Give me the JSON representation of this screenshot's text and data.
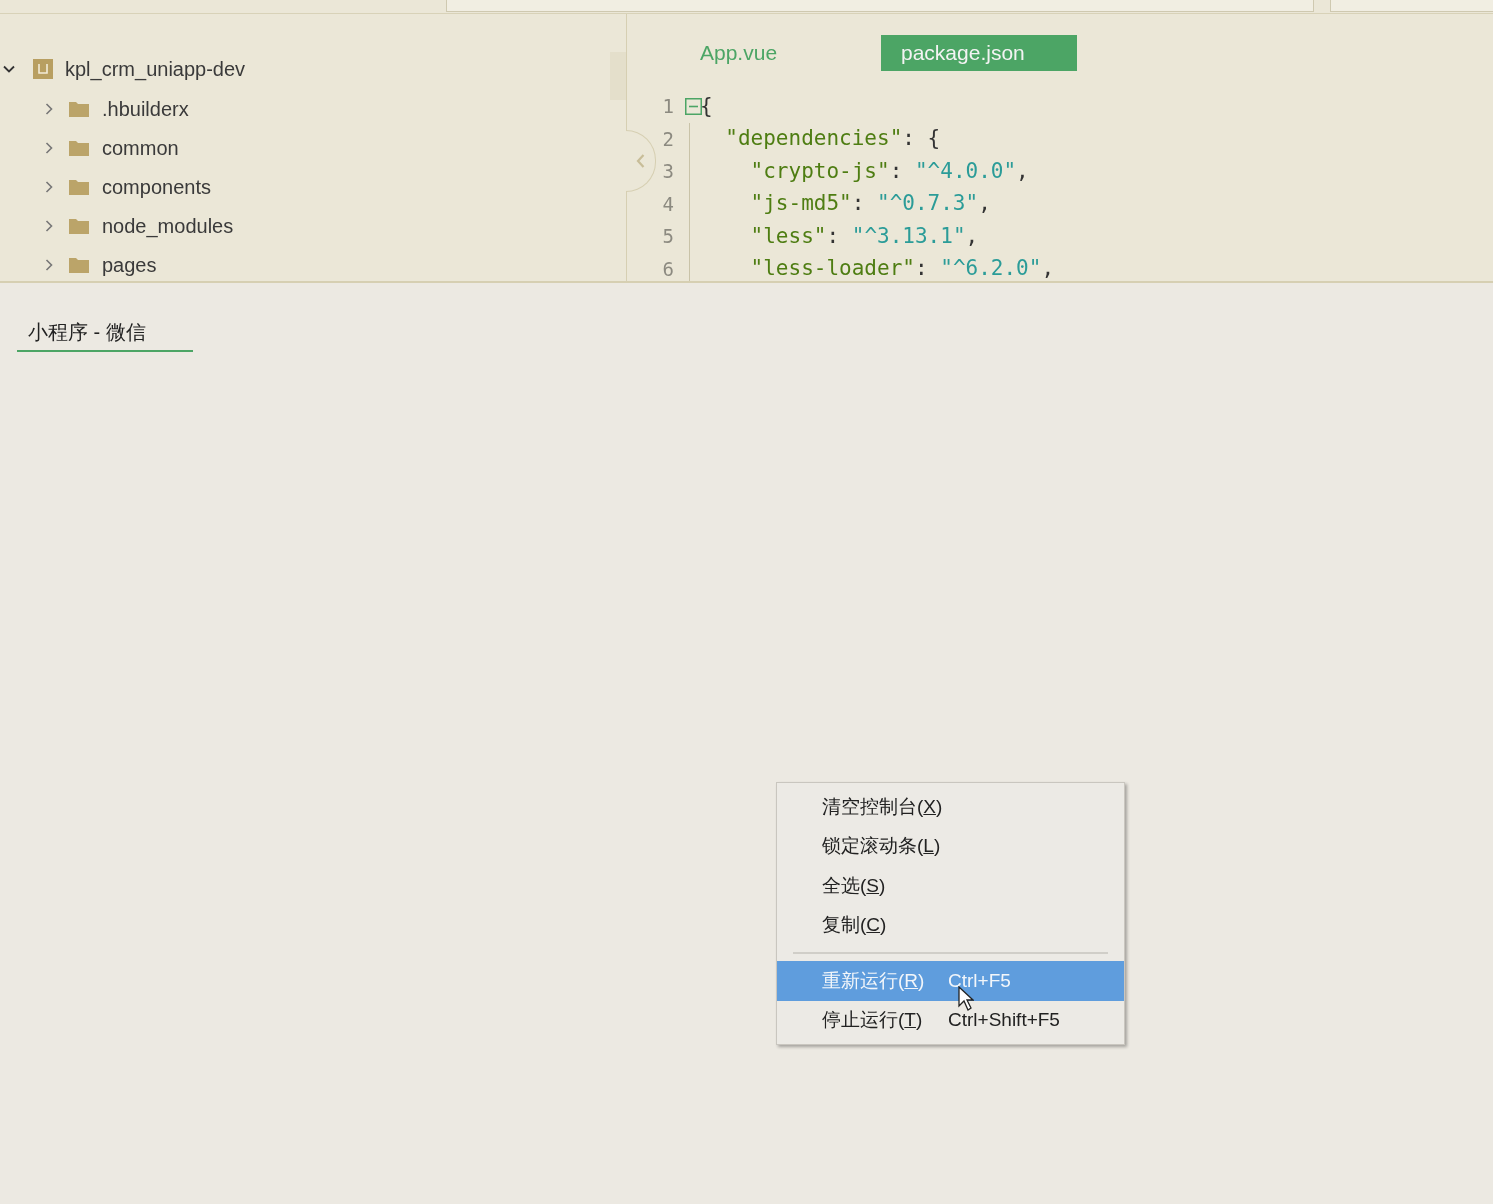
{
  "project_tree": {
    "root": {
      "label": "kpl_crm_uniapp-dev",
      "expanded": true,
      "children": [
        {
          "label": ".hbuilderx",
          "expanded": false
        },
        {
          "label": "common",
          "expanded": false
        },
        {
          "label": "components",
          "expanded": false
        },
        {
          "label": "node_modules",
          "expanded": false
        },
        {
          "label": "pages",
          "expanded": false
        }
      ]
    }
  },
  "editor": {
    "tabs": [
      {
        "label": "App.vue",
        "selected": false
      },
      {
        "label": "package.json",
        "selected": true
      }
    ],
    "lines": [
      {
        "number": "1",
        "foldable": true,
        "tokens": [
          {
            "kind": "punct",
            "text": "{"
          }
        ]
      },
      {
        "number": "2",
        "foldable": false,
        "tokens": [
          {
            "kind": "key",
            "text": "  \"dependencies\""
          },
          {
            "kind": "punct",
            "text": ": {"
          }
        ]
      },
      {
        "number": "3",
        "foldable": false,
        "tokens": [
          {
            "kind": "key",
            "text": "    \"crypto-js\""
          },
          {
            "kind": "punct",
            "text": ": "
          },
          {
            "kind": "string",
            "text": "\"^4.0.0\""
          },
          {
            "kind": "punct",
            "text": ","
          }
        ]
      },
      {
        "number": "4",
        "foldable": false,
        "tokens": [
          {
            "kind": "key",
            "text": "    \"js-md5\""
          },
          {
            "kind": "punct",
            "text": ": "
          },
          {
            "kind": "string",
            "text": "\"^0.7.3\""
          },
          {
            "kind": "punct",
            "text": ","
          }
        ]
      },
      {
        "number": "5",
        "foldable": false,
        "tokens": [
          {
            "kind": "key",
            "text": "    \"less\""
          },
          {
            "kind": "punct",
            "text": ": "
          },
          {
            "kind": "string",
            "text": "\"^3.13.1\""
          },
          {
            "kind": "punct",
            "text": ","
          }
        ]
      },
      {
        "number": "6",
        "foldable": false,
        "tokens": [
          {
            "kind": "key",
            "text": "    \"less-loader\""
          },
          {
            "kind": "punct",
            "text": ": "
          },
          {
            "kind": "string",
            "text": "\"^6.2.0\""
          },
          {
            "kind": "punct",
            "text": ","
          }
        ]
      }
    ]
  },
  "console": {
    "tabs": [
      {
        "label": "小程序 - 微信",
        "selected": true
      }
    ]
  },
  "context_menu": {
    "items": [
      {
        "kind": "item",
        "label": "清空控制台(X)",
        "selected": false
      },
      {
        "kind": "item",
        "label": "锁定滚动条(L)",
        "selected": false
      },
      {
        "kind": "item",
        "label": "全选(S)",
        "selected": false
      },
      {
        "kind": "item",
        "label": "复制(C)",
        "selected": false
      },
      {
        "kind": "separator"
      },
      {
        "kind": "item",
        "label": "重新运行(R)",
        "shortcut": "Ctrl+F5",
        "selected": true
      },
      {
        "kind": "item",
        "label": "停止运行(T)",
        "shortcut": "Ctrl+Shift+F5",
        "selected": false
      }
    ]
  }
}
